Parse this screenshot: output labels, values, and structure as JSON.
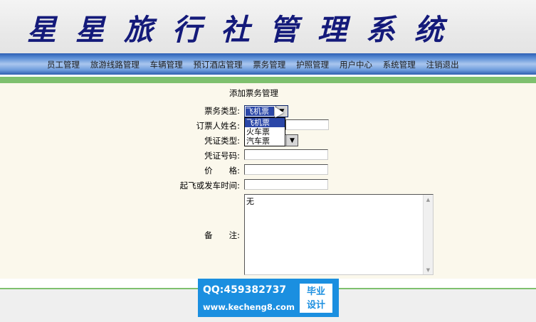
{
  "banner": {
    "title": "星星旅行社管理系统"
  },
  "nav": {
    "items": [
      "员工管理",
      "旅游线路管理",
      "车辆管理",
      "预订酒店管理",
      "票务管理",
      "护照管理",
      "用户中心",
      "系统管理",
      "注销退出"
    ]
  },
  "form": {
    "title": "添加票务管理",
    "ticket_type_label": "票务类型:",
    "ticket_type_value": "飞机票",
    "ticket_type_options": [
      "飞机票",
      "火车票",
      "汽车票"
    ],
    "booker_name_label": "订票人姓名:",
    "voucher_type_label": "凭证类型:",
    "voucher_no_label": "凭证号码:",
    "price_label": "价　　格:",
    "departure_time_label": "起飞或发车时间:",
    "remark_label": "备　　注:",
    "remark_value": "无"
  },
  "watermark": {
    "qq": "QQ:459382737",
    "site": "www.kecheng8.com",
    "badge_line1": "毕业",
    "badge_line2": "设计"
  }
}
